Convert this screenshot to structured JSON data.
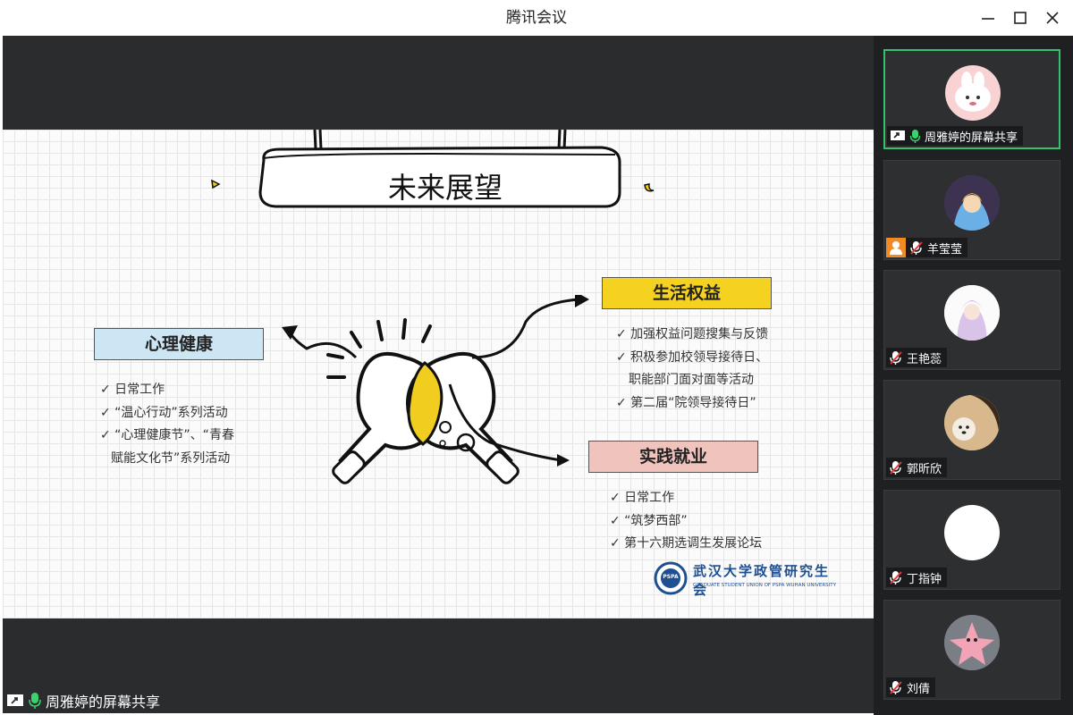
{
  "window": {
    "title": "腾讯会议"
  },
  "slide": {
    "title": "未来展望",
    "left_section": {
      "heading": "心理健康",
      "items": [
        "✓ 日常工作",
        "✓ “温心行动”系列活动",
        "✓ “心理健康节”、“青春",
        "赋能文化节”系列活动"
      ]
    },
    "right_top_section": {
      "heading": "生活权益",
      "items": [
        "✓ 加强权益问题搜集与反馈",
        "✓ 积极参加校领导接待日、",
        "职能部门面对面等活动",
        "✓ 第二届“院领导接待日”"
      ]
    },
    "right_bottom_section": {
      "heading": "实践就业",
      "items": [
        "✓  日常工作",
        "✓   “筑梦西部”",
        "✓  第十六期选调生发展论坛"
      ]
    },
    "logo": {
      "name": "武汉大学政管研究生会",
      "subtitle": "GRADUATE STUDENT UNION OF PSPA WUHAN UNIVERSITY",
      "seal": "PSPA"
    },
    "colors": {
      "blue_box": "#cde6f3",
      "yellow_box": "#f5d21f",
      "pink_box": "#f1c3bd",
      "bulb_fill": "#f0cd1e"
    }
  },
  "share_banner": {
    "label": "周雅婷的屏幕共享"
  },
  "participants": [
    {
      "name": "周雅婷的屏幕共享",
      "mic": "on",
      "sharing": true,
      "avatar": "cartoon-bunny"
    },
    {
      "name": "羊莹莹",
      "mic": "muted",
      "host": true,
      "avatar": "anime-girl"
    },
    {
      "name": "王艳蕊",
      "mic": "muted",
      "avatar": "anime-girl-white"
    },
    {
      "name": "郭昕欣",
      "mic": "muted",
      "avatar": "girl-with-dog"
    },
    {
      "name": "丁指钟",
      "mic": "muted",
      "avatar": "blank-white"
    },
    {
      "name": "刘倩",
      "mic": "muted",
      "avatar": "patrick-star"
    }
  ],
  "ui_colors": {
    "active_border": "#35c26a",
    "mic_green": "#3bd16f",
    "host_orange": "#f08a24",
    "muted_red": "#e0393e"
  }
}
